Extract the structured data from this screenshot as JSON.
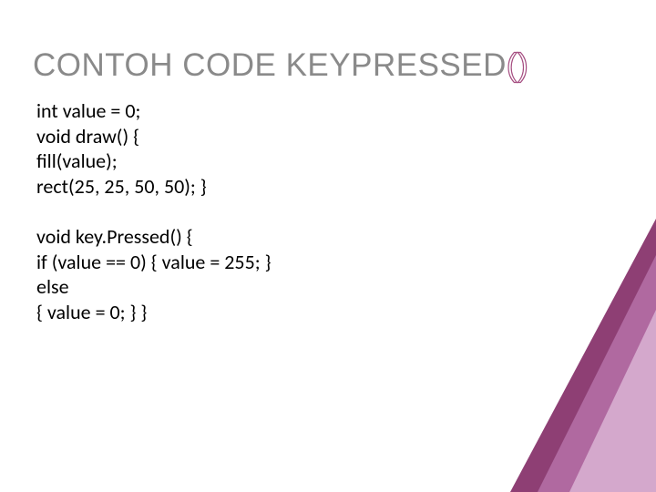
{
  "title": {
    "text_main": "CONTOH CODE KEYPRESSED",
    "paren_open": "(",
    "paren_close": ")"
  },
  "code": {
    "block1": "int value = 0;\nvoid draw() {\nfill(value);\nrect(25, 25, 50, 50); }",
    "block2": "void key.Pressed() {\nif (value == 0) { value = 255; }\nelse\n{ value = 0; } }"
  }
}
